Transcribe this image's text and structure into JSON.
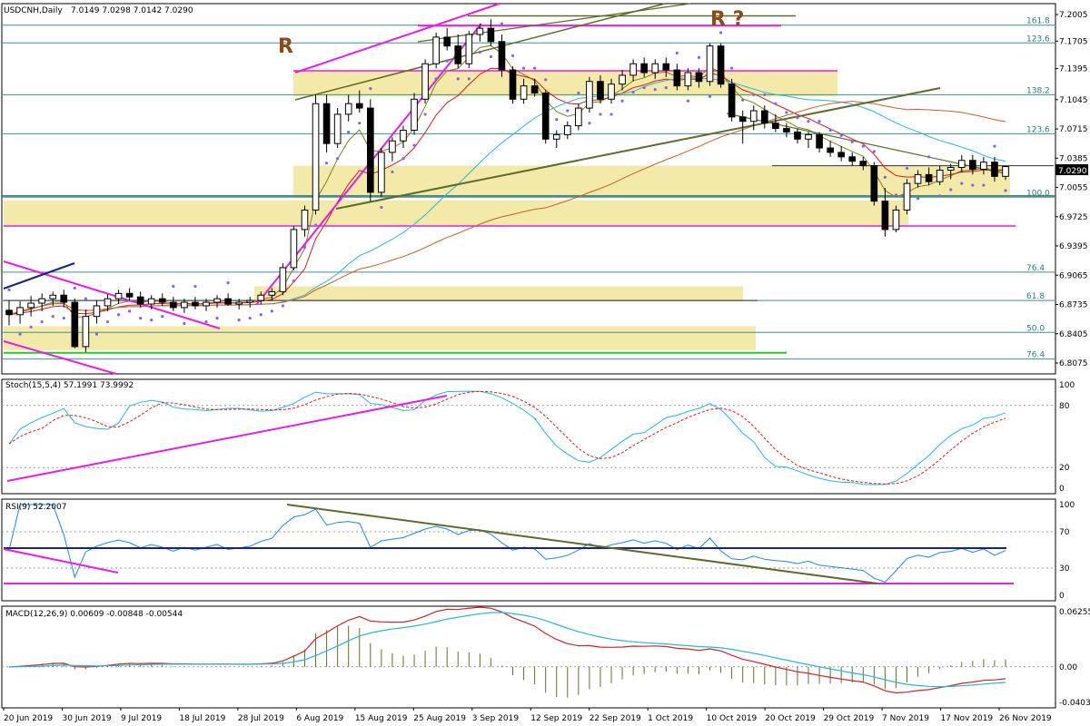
{
  "header": {
    "symbol_tf": "USDCNH,Daily",
    "ohlc": "7.0149 7.0298 7.0142 7.0290"
  },
  "price_axis_labels": [
    "7.2005",
    "7.1705",
    "7.1395",
    "7.1045",
    "7.0715",
    "7.0385",
    "7.0055",
    "6.9725",
    "6.9395",
    "6.9065",
    "6.8735",
    "6.8405",
    "6.8075"
  ],
  "current_price_label": "7.0290",
  "fib_labels": [
    "161.8",
    "123.6",
    "138.2",
    "123.6",
    "100.0",
    "76.4",
    "61.8",
    "50.0",
    "76.4"
  ],
  "annotations": {
    "r_left": "R",
    "r_right": "R ?"
  },
  "date_labels": [
    "20 Jun 2019",
    "30 Jun 2019",
    "9 Jul 2019",
    "18 Jul 2019",
    "28 Jul 2019",
    "6 Aug 2019",
    "15 Aug 2019",
    "25 Aug 2019",
    "3 Sep 2019",
    "12 Sep 2019",
    "22 Sep 2019",
    "1 Oct 2019",
    "10 Oct 2019",
    "20 Oct 2019",
    "29 Oct 2019",
    "7 Nov 2019",
    "17 Nov 2019",
    "26 Nov 2019"
  ],
  "stoch": {
    "label": "Stoch(15,5,4) 57.1991 73.9992",
    "levels": [
      "100",
      "80",
      "20",
      "0"
    ]
  },
  "rsi": {
    "label": "RSI(9) 52.2007",
    "levels": [
      "100",
      "70",
      "30",
      "0"
    ]
  },
  "macd": {
    "label": "MACD(12,26,9) 0.00609 -0.00848 -0.00544",
    "levels": [
      "0.06255",
      "0.00",
      "-0.04035"
    ]
  },
  "colors": {
    "up": "#ffffff",
    "down": "#000000",
    "grid": "#2a7a7a",
    "zone": "#f3e9a8",
    "magenta": "#e61ee6",
    "olive": "#5d6b2e",
    "sar": "#7b68ee",
    "ma_fast": "#d81b1b",
    "ma_mid": "#29b6d6",
    "ma_slow": "#c8602a",
    "ma_olive": "#7e7e1e"
  },
  "chart_data": {
    "type": "candlestick",
    "title": "USDCNH,Daily",
    "ylim": [
      6.8075,
      7.2005
    ],
    "x_start": "20 Jun 2019",
    "x_end": "29 Nov 2019",
    "candles": [
      [
        6.867,
        6.878,
        6.85,
        6.862
      ],
      [
        6.862,
        6.877,
        6.852,
        6.87
      ],
      [
        6.87,
        6.883,
        6.86,
        6.875
      ],
      [
        6.875,
        6.886,
        6.866,
        6.88
      ],
      [
        6.88,
        6.888,
        6.872,
        6.884
      ],
      [
        6.884,
        6.89,
        6.87,
        6.876
      ],
      [
        6.876,
        6.88,
        6.824,
        6.826
      ],
      [
        6.826,
        6.868,
        6.82,
        6.86
      ],
      [
        6.86,
        6.878,
        6.852,
        6.872
      ],
      [
        6.872,
        6.885,
        6.866,
        6.88
      ],
      [
        6.88,
        6.89,
        6.874,
        6.886
      ],
      [
        6.886,
        6.892,
        6.878,
        6.882
      ],
      [
        6.882,
        6.888,
        6.87,
        6.874
      ],
      [
        6.874,
        6.884,
        6.868,
        6.88
      ],
      [
        6.88,
        6.886,
        6.872,
        6.876
      ],
      [
        6.876,
        6.882,
        6.866,
        6.87
      ],
      [
        6.87,
        6.88,
        6.864,
        6.876
      ],
      [
        6.876,
        6.882,
        6.868,
        6.872
      ],
      [
        6.872,
        6.88,
        6.866,
        6.876
      ],
      [
        6.876,
        6.884,
        6.87,
        6.88
      ],
      [
        6.88,
        6.886,
        6.872,
        6.874
      ],
      [
        6.874,
        6.88,
        6.868,
        6.876
      ],
      [
        6.876,
        6.882,
        6.87,
        6.878
      ],
      [
        6.878,
        6.888,
        6.874,
        6.884
      ],
      [
        6.884,
        6.892,
        6.878,
        6.888
      ],
      [
        6.888,
        6.92,
        6.884,
        6.915
      ],
      [
        6.915,
        6.962,
        6.912,
        6.958
      ],
      [
        6.958,
        6.985,
        6.95,
        6.98
      ],
      [
        6.98,
        7.11,
        6.975,
        7.1
      ],
      [
        7.1,
        7.11,
        7.045,
        7.055
      ],
      [
        7.055,
        7.095,
        7.05,
        7.088
      ],
      [
        7.088,
        7.11,
        7.08,
        7.1
      ],
      [
        7.1,
        7.115,
        7.09,
        7.095
      ],
      [
        7.095,
        7.105,
        6.99,
        7.0
      ],
      [
        7.0,
        7.05,
        6.995,
        7.045
      ],
      [
        7.045,
        7.062,
        7.035,
        7.058
      ],
      [
        7.058,
        7.075,
        7.05,
        7.07
      ],
      [
        7.07,
        7.112,
        7.065,
        7.105
      ],
      [
        7.105,
        7.15,
        7.1,
        7.145
      ],
      [
        7.145,
        7.18,
        7.14,
        7.175
      ],
      [
        7.175,
        7.185,
        7.16,
        7.165
      ],
      [
        7.165,
        7.178,
        7.14,
        7.145
      ],
      [
        7.145,
        7.182,
        7.14,
        7.178
      ],
      [
        7.178,
        7.19,
        7.17,
        7.185
      ],
      [
        7.185,
        7.195,
        7.165,
        7.17
      ],
      [
        7.17,
        7.178,
        7.13,
        7.138
      ],
      [
        7.138,
        7.142,
        7.1,
        7.105
      ],
      [
        7.105,
        7.128,
        7.1,
        7.12
      ],
      [
        7.12,
        7.128,
        7.108,
        7.112
      ],
      [
        7.112,
        7.115,
        7.055,
        7.06
      ],
      [
        7.06,
        7.07,
        7.05,
        7.065
      ],
      [
        7.065,
        7.08,
        7.06,
        7.075
      ],
      [
        7.075,
        7.1,
        7.07,
        7.095
      ],
      [
        7.095,
        7.13,
        7.09,
        7.125
      ],
      [
        7.125,
        7.132,
        7.1,
        7.105
      ],
      [
        7.105,
        7.128,
        7.1,
        7.122
      ],
      [
        7.122,
        7.138,
        7.115,
        7.132
      ],
      [
        7.132,
        7.15,
        7.125,
        7.145
      ],
      [
        7.145,
        7.152,
        7.13,
        7.135
      ],
      [
        7.135,
        7.15,
        7.128,
        7.145
      ],
      [
        7.145,
        7.152,
        7.13,
        7.138
      ],
      [
        7.138,
        7.145,
        7.115,
        7.12
      ],
      [
        7.12,
        7.14,
        7.115,
        7.135
      ],
      [
        7.135,
        7.14,
        7.118,
        7.125
      ],
      [
        7.125,
        7.168,
        7.12,
        7.165
      ],
      [
        7.165,
        7.168,
        7.118,
        7.122
      ],
      [
        7.122,
        7.128,
        7.08,
        7.085
      ],
      [
        7.085,
        7.092,
        7.055,
        7.08
      ],
      [
        7.08,
        7.098,
        7.07,
        7.092
      ],
      [
        7.092,
        7.098,
        7.072,
        7.078
      ],
      [
        7.078,
        7.088,
        7.068,
        7.072
      ],
      [
        7.072,
        7.078,
        7.062,
        7.068
      ],
      [
        7.068,
        7.072,
        7.055,
        7.06
      ],
      [
        7.06,
        7.068,
        7.05,
        7.065
      ],
      [
        7.065,
        7.068,
        7.045,
        7.05
      ],
      [
        7.05,
        7.058,
        7.04,
        7.045
      ],
      [
        7.045,
        7.052,
        7.035,
        7.04
      ],
      [
        7.04,
        7.045,
        7.03,
        7.035
      ],
      [
        7.035,
        7.04,
        7.025,
        7.03
      ],
      [
        7.03,
        7.034,
        6.985,
        6.99
      ],
      [
        6.99,
        7.005,
        6.95,
        6.958
      ],
      [
        6.958,
        6.985,
        6.955,
        6.98
      ],
      [
        6.98,
        7.015,
        6.975,
        7.01
      ],
      [
        7.01,
        7.025,
        7.005,
        7.02
      ],
      [
        7.02,
        7.028,
        7.008,
        7.012
      ],
      [
        7.012,
        7.03,
        7.008,
        7.025
      ],
      [
        7.025,
        7.032,
        7.015,
        7.028
      ],
      [
        7.028,
        7.042,
        7.022,
        7.036
      ],
      [
        7.036,
        7.042,
        7.02,
        7.026
      ],
      [
        7.026,
        7.04,
        7.02,
        7.034
      ],
      [
        7.034,
        7.04,
        7.012,
        7.018
      ],
      [
        7.018,
        7.03,
        7.014,
        7.029
      ]
    ]
  }
}
